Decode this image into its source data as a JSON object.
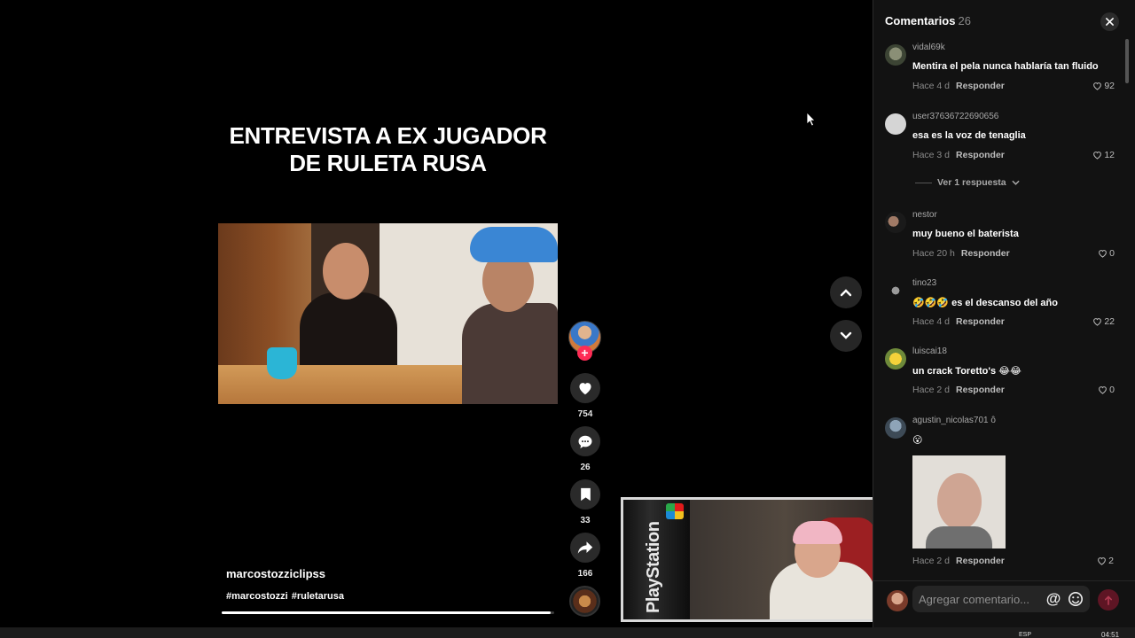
{
  "video": {
    "caption": "ENTREVISTA A EX JUGADOR DE RULETA RUSA",
    "author": "marcostozziclipss",
    "hashtags": [
      "#marcostozzi",
      "#ruletarusa"
    ],
    "progress": 0.99
  },
  "actions": {
    "likes": "754",
    "comments": "26",
    "saves": "33",
    "shares": "166"
  },
  "webcam": {
    "cover_text": "PlayStation"
  },
  "panel": {
    "title": "Comentarios",
    "count": "26",
    "reply_label": "Responder",
    "see_replies": "Ver 1 respuesta",
    "input_placeholder": "Agregar comentario...",
    "mention_symbol": "@"
  },
  "comments": [
    {
      "user": "vidal69k",
      "text": "Mentira el pela nunca hablaría tan fluido",
      "time": "Hace 4 d",
      "likes": "92"
    },
    {
      "user": "user37636722690656",
      "text": "esa es la voz de tenaglia",
      "time": "Hace 3 d",
      "likes": "12"
    },
    {
      "user": "nestor",
      "text": "muy bueno el baterista",
      "time": "Hace 20 h",
      "likes": "0"
    },
    {
      "user": "tino23",
      "text": "🤣🤣🤣 es el descanso del año",
      "time": "Hace 4 d",
      "likes": "22"
    },
    {
      "user": "luiscai18",
      "text": "un crack Toretto's 😂😂",
      "time": "Hace 2 d",
      "likes": "0"
    },
    {
      "user": "agustin_nicolas701 ô",
      "text": "😮",
      "time": "Hace 2 d",
      "likes": "2"
    }
  ],
  "taskbar": {
    "lang": "ESP",
    "time": "04:51"
  },
  "colors": {
    "accent": "#fe2c55",
    "panel_bg": "#121212",
    "video_bg": "#000000"
  },
  "icons": [
    "heart-icon",
    "comment-bubble-icon",
    "bookmark-icon",
    "share-arrow-icon",
    "chevron-up-icon",
    "chevron-down-icon",
    "close-icon",
    "emoji-icon",
    "send-arrow-icon",
    "mouse-cursor-icon"
  ]
}
